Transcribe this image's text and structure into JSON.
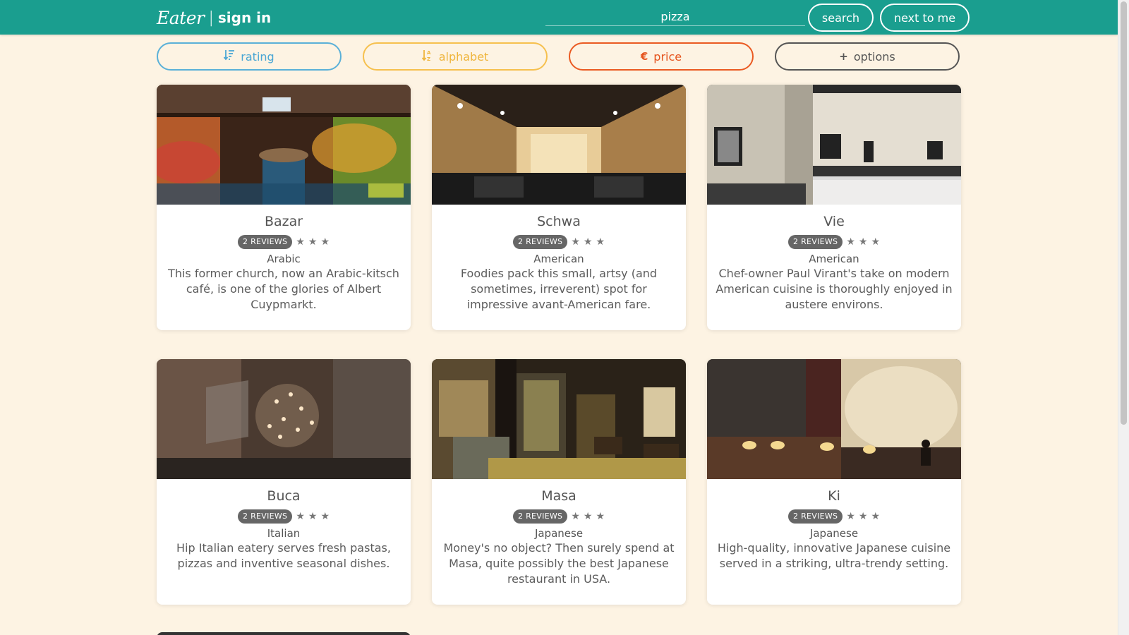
{
  "header": {
    "logo": "Eater",
    "separator": "|",
    "sign_in": "sign in",
    "search_value": "pizza",
    "search_button": "search",
    "near_button": "next to me"
  },
  "filters": [
    {
      "label": "rating",
      "icon": "sort-amount-icon"
    },
    {
      "label": "alphabet",
      "icon": "sort-alpha-icon"
    },
    {
      "label": "price",
      "icon": "euro-icon",
      "symbol": "€"
    },
    {
      "label": "options",
      "icon": "plus-icon",
      "symbol": "+"
    }
  ],
  "colors": {
    "header": "#1a9e8f",
    "background": "#fdf3e3",
    "rating": "#4aa6d4",
    "alphabet": "#efb53c",
    "price": "#e5531d",
    "options": "#555555"
  },
  "restaurants": [
    {
      "name": "Bazar",
      "reviews": "2 REVIEWS",
      "stars": 3,
      "cuisine": "Arabic",
      "description": "This former church, now an Arabic-kitsch café, is one of the glories of Albert Cuypmarkt."
    },
    {
      "name": "Schwa",
      "reviews": "2 REVIEWS",
      "stars": 3,
      "cuisine": "American",
      "description": "Foodies pack this small, artsy (and sometimes, irreverent) spot for impressive avant-American fare."
    },
    {
      "name": "Vie",
      "reviews": "2 REVIEWS",
      "stars": 3,
      "cuisine": "American",
      "description": "Chef-owner Paul Virant's take on modern American cuisine is thoroughly enjoyed in austere environs."
    },
    {
      "name": "Buca",
      "reviews": "2 REVIEWS",
      "stars": 3,
      "cuisine": "Italian",
      "description": "Hip Italian eatery serves fresh pastas, pizzas and inventive seasonal dishes."
    },
    {
      "name": "Masa",
      "reviews": "2 REVIEWS",
      "stars": 3,
      "cuisine": "Japanese",
      "description": "Money's no object? Then surely spend at Masa, quite possibly the best Japanese restaurant in USA."
    },
    {
      "name": "Ki",
      "reviews": "2 REVIEWS",
      "stars": 3,
      "cuisine": "Japanese",
      "description": "High-quality, innovative Japanese cuisine served in a striking, ultra-trendy setting."
    }
  ]
}
